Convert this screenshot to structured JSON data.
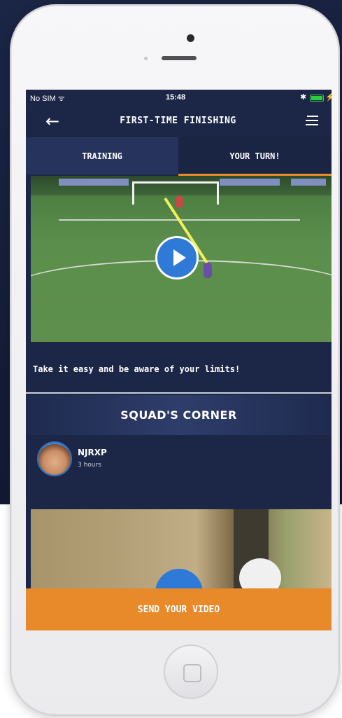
{
  "status_bar": {
    "carrier": "No SIM ᯤ",
    "time": "15:48",
    "bluetooth": "✱",
    "charging": "⚡"
  },
  "header": {
    "back_icon": "←",
    "title": "FIRST-TIME FINISHING",
    "menu_icon": "hamburger-icon"
  },
  "tabs": [
    {
      "label": "TRAINING",
      "active": false
    },
    {
      "label": "YOUR TURN!",
      "active": true
    }
  ],
  "main": {
    "tip": "Take it easy and be aware of your limits!"
  },
  "squad": {
    "title": "SQUAD'S CORNER",
    "post": {
      "user": "NJRXP",
      "time": "3 hours"
    }
  },
  "cta": {
    "label": "SEND YOUR VIDEO"
  },
  "colors": {
    "accent": "#e8892a",
    "navy": "#1c2748",
    "play": "#2f7ad6"
  }
}
